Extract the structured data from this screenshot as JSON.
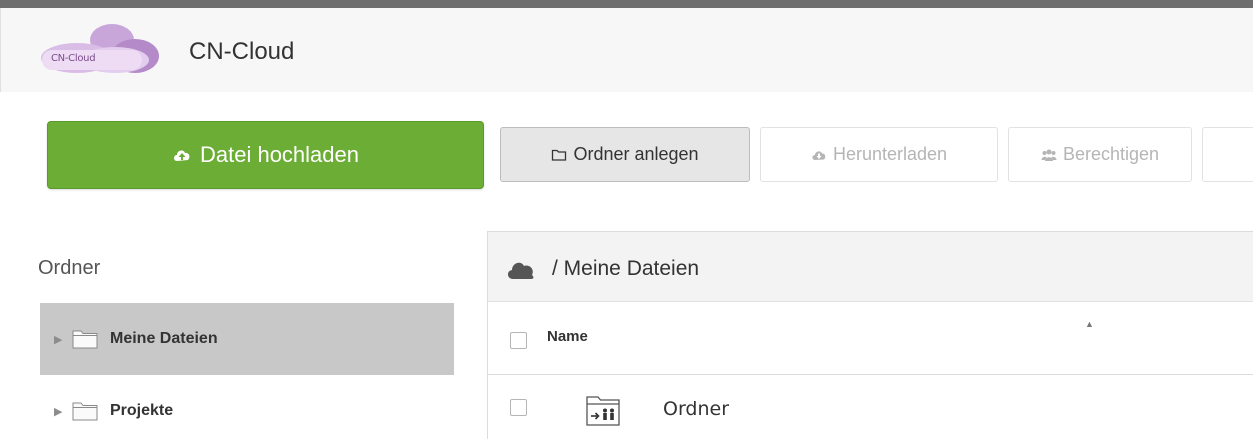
{
  "app": {
    "logo_text": "CN-Cloud",
    "title": "CN-Cloud"
  },
  "toolbar": {
    "upload_label": "Datei hochladen",
    "new_folder_label": "Ordner anlegen",
    "download_label": "Herunterladen",
    "permissions_label": "Berechtigen"
  },
  "sidebar": {
    "title": "Ordner",
    "items": [
      {
        "label": "Meine Dateien",
        "selected": true
      },
      {
        "label": "Projekte",
        "selected": false
      }
    ]
  },
  "main": {
    "breadcrumb": "/ Meine Dateien",
    "columns": {
      "name": "Name"
    },
    "rows": [
      {
        "name": "Ordner"
      }
    ]
  },
  "colors": {
    "upload_button": "#6cad35",
    "selected_item": "#c8c8c8",
    "logo_accent": "#9c6fb4"
  }
}
